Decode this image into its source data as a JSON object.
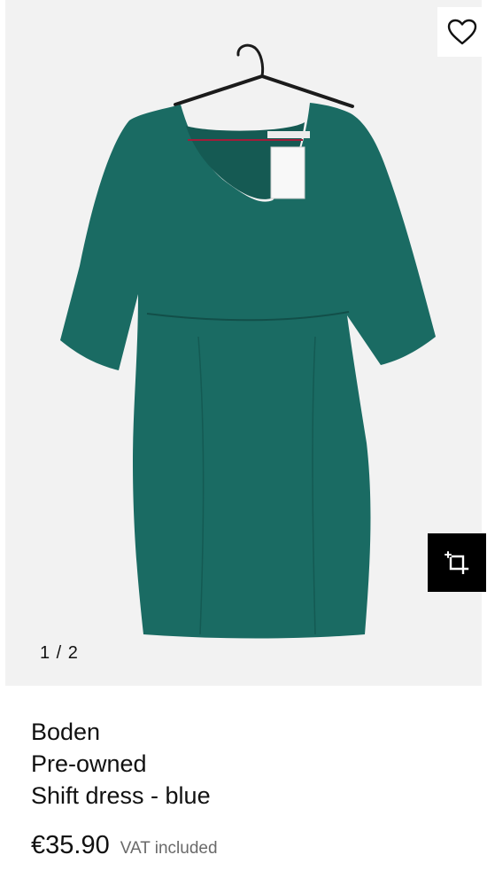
{
  "gallery": {
    "pager": "1 / 2",
    "image_subject": "green-three-quarter-sleeve-shift-dress-on-hanger",
    "dress_color": "#1a6b63",
    "wishlist_icon": "heart-outline-icon",
    "crop_icon": "crop-sparkle-icon"
  },
  "product": {
    "brand": "Boden",
    "condition": "Pre-owned",
    "name": "Shift dress - blue",
    "price": "€35.90",
    "vat_note": "VAT included"
  }
}
